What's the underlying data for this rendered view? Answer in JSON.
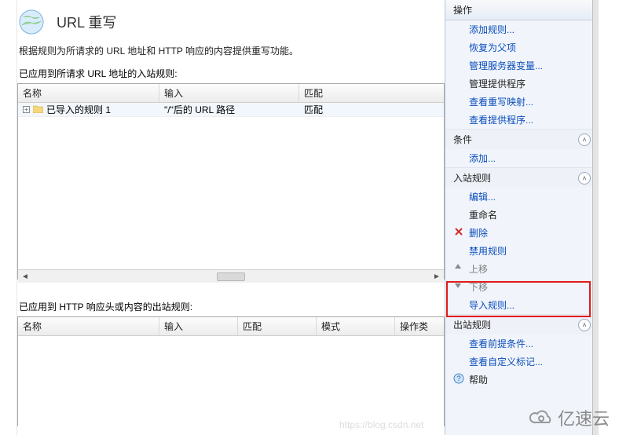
{
  "title": "URL 重写",
  "description": "根据规则为所请求的 URL 地址和 HTTP 响应的内容提供重写功能。",
  "inbound": {
    "section_label": "已应用到所请求 URL 地址的入站规则:",
    "headers": {
      "name": "名称",
      "input": "输入",
      "match": "匹配"
    },
    "rows": [
      {
        "name": "已导入的规则 1",
        "input": "\"/\"后的 URL 路径",
        "match": "匹配"
      }
    ]
  },
  "outbound": {
    "section_label": "已应用到 HTTP 响应头或内容的出站规则:",
    "headers": {
      "name": "名称",
      "input": "输入",
      "match": "匹配",
      "mode": "模式",
      "ops": "操作类"
    }
  },
  "actions": {
    "pane_title": "操作",
    "top_links": {
      "add_rules": "添加规则...",
      "restore_parent": "恢复为父项",
      "manage_server_vars": "管理服务器变量...",
      "manage_providers": "管理提供程序",
      "view_rewrite_maps": "查看重写映射...",
      "view_providers": "查看提供程序..."
    },
    "conditions": {
      "title": "条件",
      "add": "添加..."
    },
    "inbound_rules": {
      "title": "入站规则",
      "edit": "编辑...",
      "rename": "重命名",
      "delete": "删除",
      "disable": "禁用规则",
      "move_up": "上移",
      "move_down": "下移",
      "import_rules": "导入规则..."
    },
    "outbound_rules": {
      "title": "出站规则",
      "view_preconditions": "查看前提条件...",
      "view_custom_tags": "查看自定义标记..."
    },
    "help": "帮助"
  }
}
